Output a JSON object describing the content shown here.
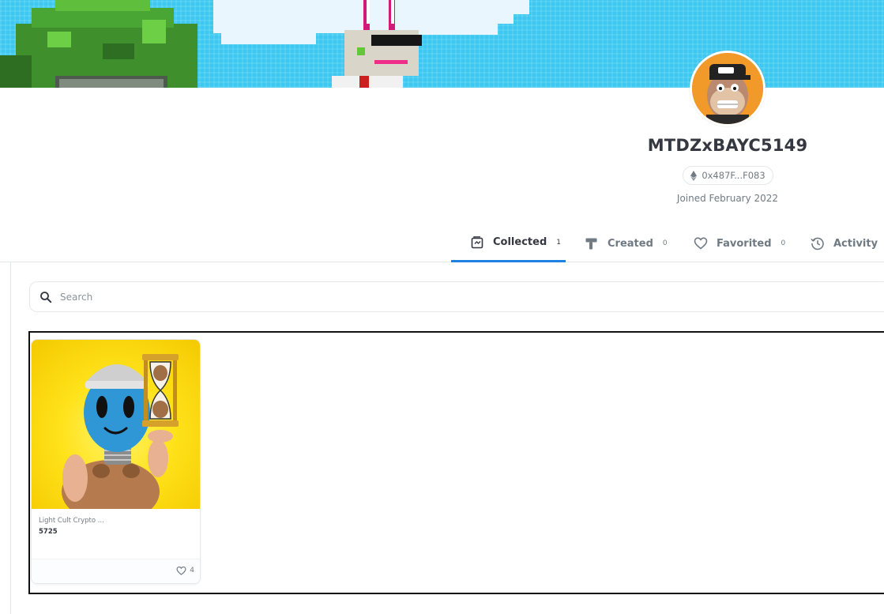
{
  "profile": {
    "name": "MTDZxBAYC5149",
    "address": "0x487F...F083",
    "joined": "Joined February 2022"
  },
  "tabs": [
    {
      "label": "Collected",
      "count": "1"
    },
    {
      "label": "Created",
      "count": "0"
    },
    {
      "label": "Favorited",
      "count": "0"
    },
    {
      "label": "Activity",
      "count": ""
    }
  ],
  "search": {
    "placeholder": "Search",
    "value": ""
  },
  "assets": [
    {
      "collection": "Light Cult Crypto ...",
      "name": "5725",
      "likes": "4"
    }
  ],
  "icons": {
    "address": "ethereum-icon",
    "collected": "collected-icon",
    "created": "created-icon",
    "favorited": "heart-icon",
    "activity": "activity-icon",
    "search": "search-icon",
    "like": "heart-icon"
  },
  "colors": {
    "accent": "#2081e2",
    "text": "#353840",
    "muted": "#707a83",
    "border": "#e5e8eb",
    "banner_sky": "#3cc8f0",
    "avatar_bg": "#f19a29",
    "asset_bg": "#ffe21a"
  }
}
